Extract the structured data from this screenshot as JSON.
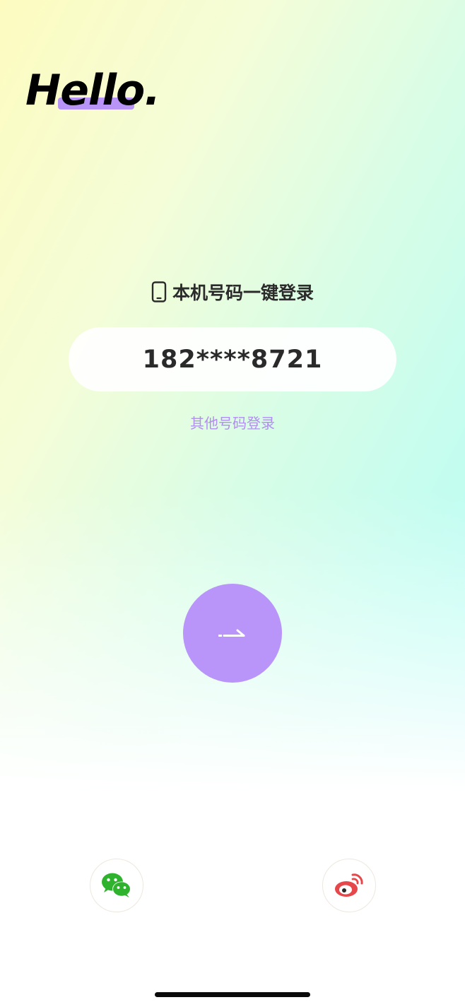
{
  "greeting": {
    "text": "Hello",
    "dot": "."
  },
  "one_key_login": {
    "icon": "phone-icon",
    "label": "本机号码一键登录"
  },
  "phone_number": {
    "masked": "182****8721"
  },
  "other_number_link": {
    "label": "其他号码登录",
    "color": "#b28ef0"
  },
  "submit_button": {
    "icon": "arrow-right-icon",
    "color": "#b995fa"
  },
  "social_login": [
    {
      "name": "wechat",
      "icon": "wechat-icon",
      "color": "#2fb32f"
    },
    {
      "name": "weibo",
      "icon": "weibo-icon",
      "color": "#e6474a"
    }
  ],
  "theme": {
    "accent": "#b894f6",
    "text": "#2b2b2b"
  }
}
